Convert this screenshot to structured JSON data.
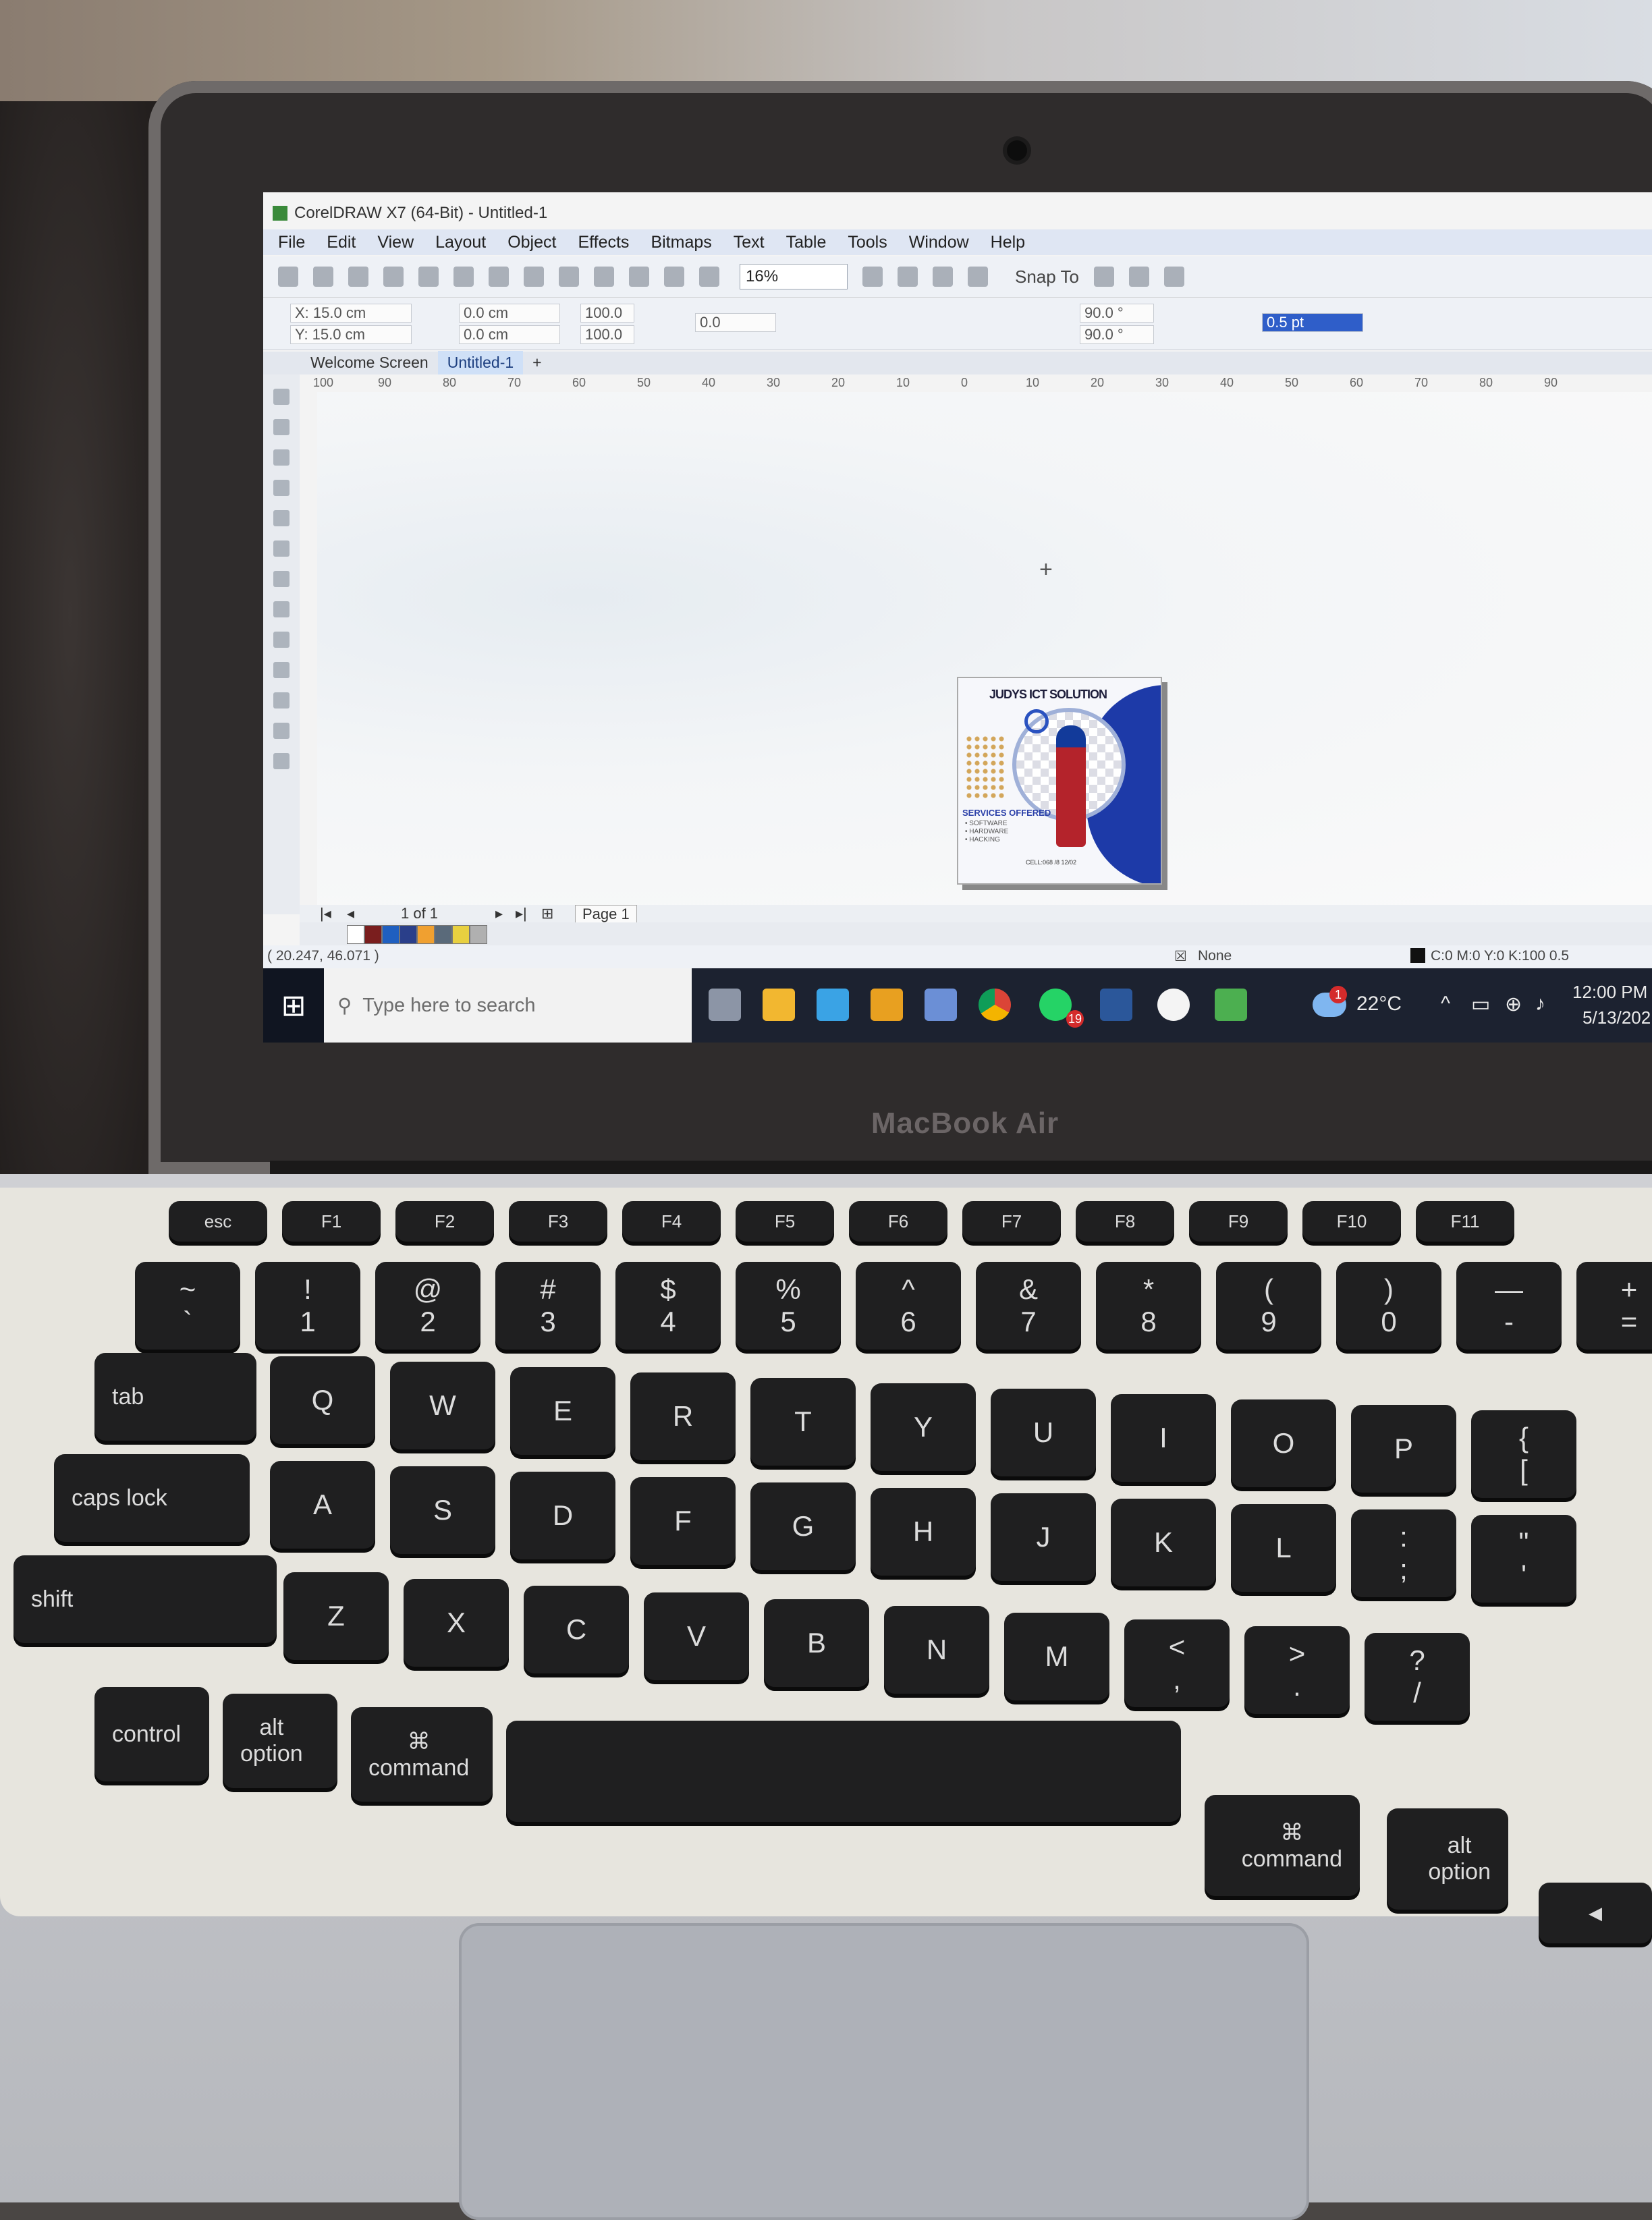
{
  "scene": {
    "brand_label": "MacBook Air"
  },
  "app": {
    "title": "CorelDRAW X7 (64-Bit) - Untitled-1",
    "menu": [
      "File",
      "Edit",
      "View",
      "Layout",
      "Object",
      "Effects",
      "Bitmaps",
      "Text",
      "Table",
      "Tools",
      "Window",
      "Help"
    ],
    "zoom": "16%",
    "snap_to": "Snap To",
    "props": {
      "x": "X: 15.0 cm",
      "y": "Y: 15.0 cm",
      "w": "0.0 cm",
      "h": "0.0 cm",
      "scale_x": "100.0",
      "scale_y": "100.0",
      "pct": "%",
      "rotation": "0.0",
      "angle1": "90.0 °",
      "angle2": "90.0 °",
      "outline": "0.5 pt"
    },
    "tabs": [
      "Welcome Screen",
      "Untitled-1"
    ],
    "ruler_ticks": [
      "100",
      "90",
      "80",
      "70",
      "60",
      "50",
      "40",
      "30",
      "20",
      "10",
      "0",
      "10",
      "20",
      "30",
      "40",
      "50",
      "60",
      "70",
      "80",
      "90"
    ],
    "poster": {
      "title": "JUDYS ICT SOLUTION",
      "services": "SERVICES OFFERED",
      "items": [
        "• SOFTWARE",
        "• HARDWARE",
        "• HACKING"
      ],
      "phone": "CELL:068 /8 12/02"
    },
    "pagebar": {
      "page_count": "1 of 1",
      "page_tab": "Page 1"
    },
    "palette_colors": [
      "#ffffff",
      "#7a1e1e",
      "#1f5fc0",
      "#2a3f8a",
      "#f0a030",
      "#5a6a7a",
      "#e8d040",
      "#b0b0b0"
    ],
    "status": {
      "coords": "( 20.247, 46.071 )",
      "fill": "None",
      "outline_color": "C:0 M:0 Y:0 K:100  0.5"
    }
  },
  "taskbar": {
    "search_placeholder": "Type here to search",
    "whatsapp_badge": "19",
    "weather": "22°C",
    "weather_badge": "1",
    "time": "12:00 PM",
    "date": "5/13/202"
  },
  "keyboard": {
    "fn_row": [
      "esc",
      "F1",
      "F2",
      "F3",
      "F4",
      "F5",
      "F6",
      "F7",
      "F8",
      "F9",
      "F10",
      "F11"
    ],
    "number_row": [
      "~\n`",
      "!\n1",
      "@\n2",
      "#\n3",
      "$\n4",
      "%\n5",
      "^\n6",
      "&\n7",
      "*\n8",
      "(\n9",
      ")\n0",
      "—\n-",
      "+\n="
    ],
    "q_row": [
      "tab",
      "Q",
      "W",
      "E",
      "R",
      "T",
      "Y",
      "U",
      "I",
      "O",
      "P",
      "{\n["
    ],
    "a_row": [
      "caps lock",
      "A",
      "S",
      "D",
      "F",
      "G",
      "H",
      "J",
      "K",
      "L",
      ":\n;",
      "\"\n'"
    ],
    "z_row": [
      "shift",
      "Z",
      "X",
      "C",
      "V",
      "B",
      "N",
      "M",
      "<\n,",
      ">\n.",
      "?\n/"
    ],
    "bottom_row": {
      "control": "control",
      "option_l": "option",
      "alt_l": "alt",
      "command_l": "command",
      "cmd_symbol": "⌘",
      "command_r": "command",
      "option_r": "option",
      "alt_r": "alt",
      "arrow": "◀"
    }
  }
}
